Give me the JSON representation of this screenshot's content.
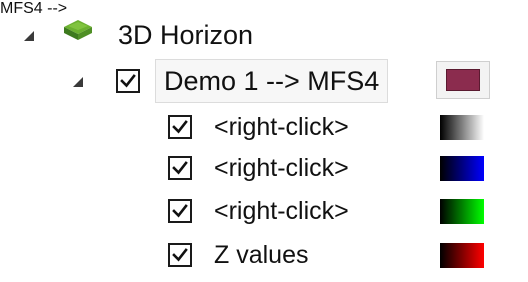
{
  "tree": {
    "root": {
      "label": "3D Horizon",
      "icon": "horizon-icon",
      "expanded": true,
      "icon_color": "#4f8a2a"
    },
    "node": {
      "label": "Demo 1 --> MFS4",
      "checked": true,
      "expanded": true,
      "color": "#8b2c4e"
    },
    "children": [
      {
        "label": "<right-click>",
        "checked": true,
        "gradient_from": "#000000",
        "gradient_to": "#ffffff"
      },
      {
        "label": "<right-click>",
        "checked": true,
        "gradient_from": "#000000",
        "gradient_to": "#0000ff"
      },
      {
        "label": "<right-click>",
        "checked": true,
        "gradient_from": "#000000",
        "gradient_to": "#00ff00"
      },
      {
        "label": "Z values",
        "checked": true,
        "gradient_from": "#000000",
        "gradient_to": "#ff0000"
      }
    ]
  }
}
